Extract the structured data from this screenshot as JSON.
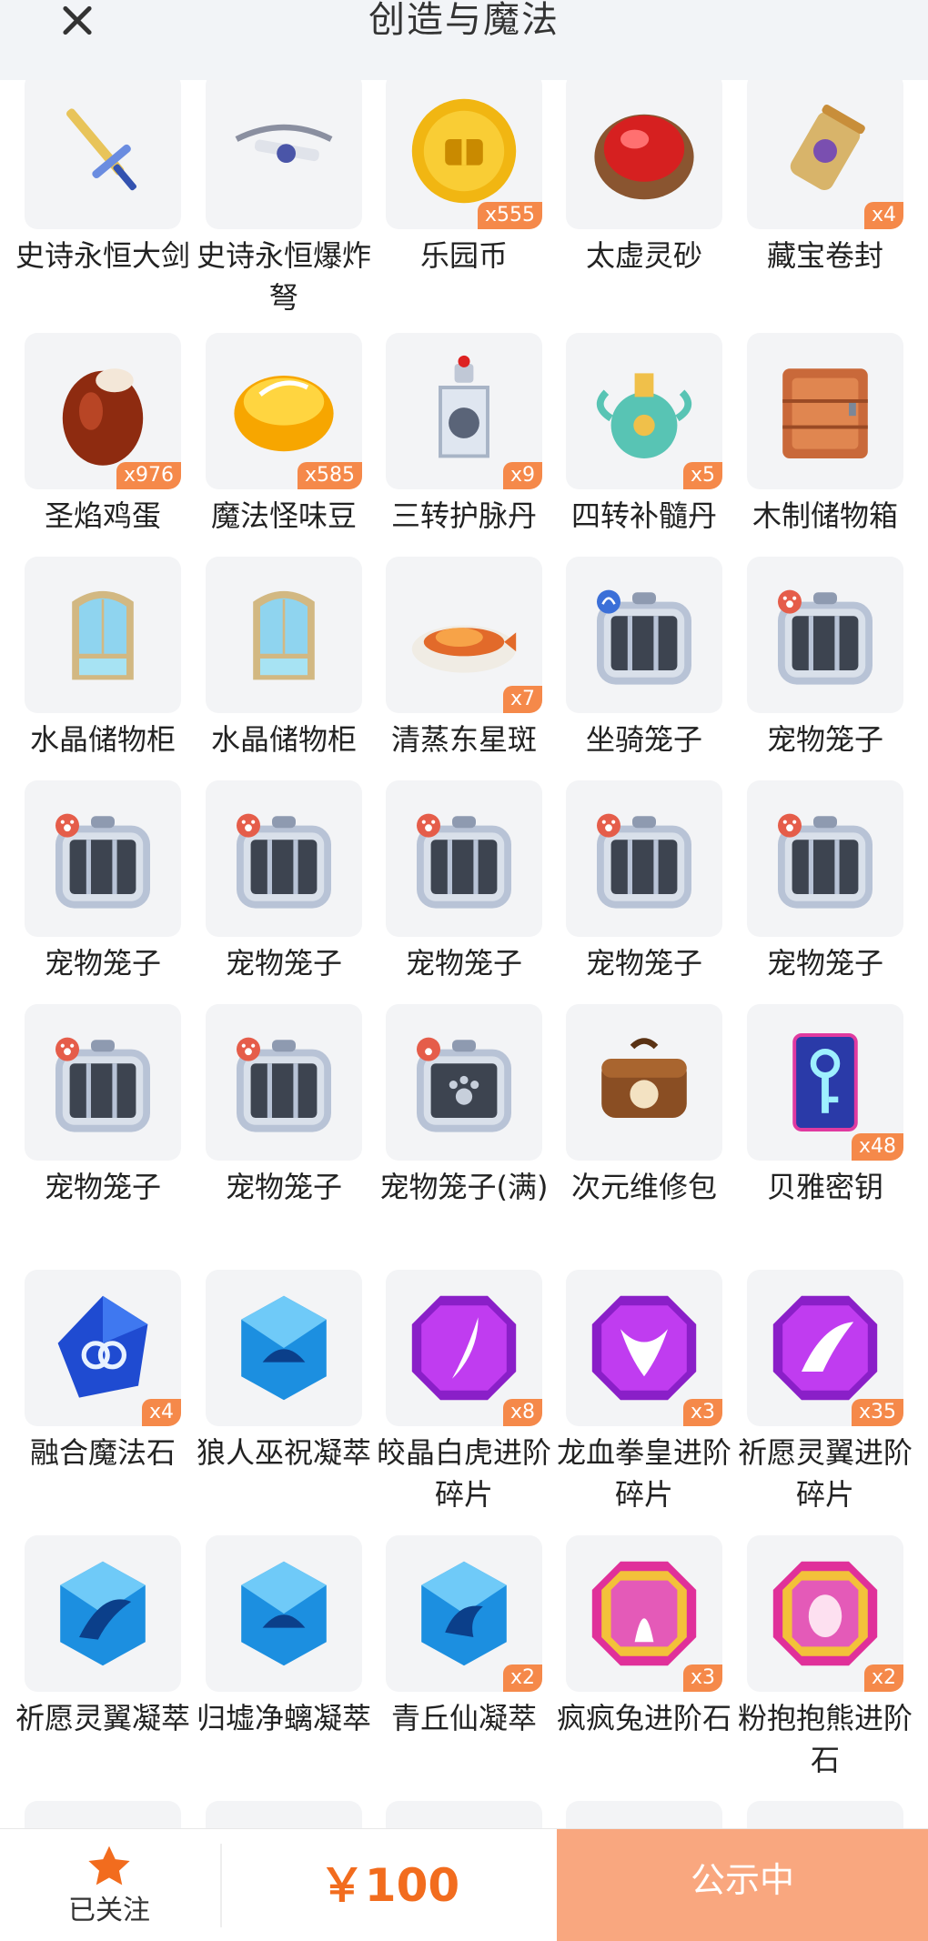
{
  "header": {
    "title": "创造与魔法"
  },
  "items": [
    {
      "name": "史诗永恒大剑",
      "qty": "",
      "icon": "sword-icon"
    },
    {
      "name": "史诗永恒爆炸弩",
      "qty": "",
      "icon": "crossbow-icon"
    },
    {
      "name": "乐园币",
      "qty": "x555",
      "icon": "coin-icon"
    },
    {
      "name": "太虚灵砂",
      "qty": "",
      "icon": "red-gem-icon"
    },
    {
      "name": "藏宝卷封",
      "qty": "x4",
      "icon": "scroll-icon"
    },
    {
      "name": "圣焰鸡蛋",
      "qty": "x976",
      "icon": "egg-icon"
    },
    {
      "name": "魔法怪味豆",
      "qty": "x585",
      "icon": "bean-icon"
    },
    {
      "name": "三转护脉丹",
      "qty": "x9",
      "icon": "potion-icon"
    },
    {
      "name": "四转补髓丹",
      "qty": "x5",
      "icon": "elixir-icon"
    },
    {
      "name": "木制储物箱",
      "qty": "",
      "icon": "wooden-chest-icon"
    },
    {
      "name": "水晶储物柜",
      "qty": "",
      "icon": "crystal-cabinet-icon"
    },
    {
      "name": "水晶储物柜",
      "qty": "",
      "icon": "crystal-cabinet-icon"
    },
    {
      "name": "清蒸东星斑",
      "qty": "x7",
      "icon": "fish-dish-icon"
    },
    {
      "name": "坐骑笼子",
      "qty": "",
      "icon": "mount-cage-icon"
    },
    {
      "name": "宠物笼子",
      "qty": "",
      "icon": "pet-cage-icon"
    },
    {
      "name": "宠物笼子",
      "qty": "",
      "icon": "pet-cage-icon"
    },
    {
      "name": "宠物笼子",
      "qty": "",
      "icon": "pet-cage-icon"
    },
    {
      "name": "宠物笼子",
      "qty": "",
      "icon": "pet-cage-icon"
    },
    {
      "name": "宠物笼子",
      "qty": "",
      "icon": "pet-cage-icon"
    },
    {
      "name": "宠物笼子",
      "qty": "",
      "icon": "pet-cage-icon"
    },
    {
      "name": "宠物笼子",
      "qty": "",
      "icon": "pet-cage-icon"
    },
    {
      "name": "宠物笼子",
      "qty": "",
      "icon": "pet-cage-icon"
    },
    {
      "name": "宠物笼子(满)",
      "qty": "",
      "icon": "pet-cage-full-icon"
    },
    {
      "name": "次元维修包",
      "qty": "",
      "icon": "repair-bag-icon"
    },
    {
      "name": "贝雅密钥",
      "qty": "x48",
      "icon": "key-card-icon"
    },
    {
      "name": "融合魔法石",
      "qty": "x4",
      "icon": "fusion-stone-icon"
    },
    {
      "name": "狼人巫祝凝萃",
      "qty": "",
      "icon": "blue-crystal-icon"
    },
    {
      "name": "皎晶白虎进阶碎片",
      "qty": "x8",
      "icon": "purple-gem-claw-icon"
    },
    {
      "name": "龙血拳皇进阶碎片",
      "qty": "x3",
      "icon": "purple-gem-bull-icon"
    },
    {
      "name": "祈愿灵翼进阶碎片",
      "qty": "x35",
      "icon": "purple-gem-wing-icon"
    },
    {
      "name": "祈愿灵翼凝萃",
      "qty": "",
      "icon": "blue-crystal-wing-icon"
    },
    {
      "name": "归墟净螭凝萃",
      "qty": "",
      "icon": "blue-crystal-icon"
    },
    {
      "name": "青丘仙凝萃",
      "qty": "x2",
      "icon": "blue-crystal-fox-icon"
    },
    {
      "name": "疯疯兔进阶石",
      "qty": "x3",
      "icon": "rainbow-gem-rabbit-icon"
    },
    {
      "name": "粉抱抱熊进阶石",
      "qty": "x2",
      "icon": "rainbow-gem-egg-icon"
    },
    {
      "name": "",
      "qty": "",
      "icon": "partial-item"
    },
    {
      "name": "",
      "qty": "",
      "icon": "partial-item"
    },
    {
      "name": "",
      "qty": "",
      "icon": "partial-item"
    },
    {
      "name": "",
      "qty": "",
      "icon": "partial-item"
    },
    {
      "name": "",
      "qty": "",
      "icon": "partial-item"
    }
  ],
  "bottom": {
    "follow_label": "已关注",
    "price": "￥100",
    "status_label": "公示中"
  },
  "colors": {
    "accent": "#f26c1e",
    "qty_badge": "#f5894a",
    "status_button": "#f9a77f"
  }
}
